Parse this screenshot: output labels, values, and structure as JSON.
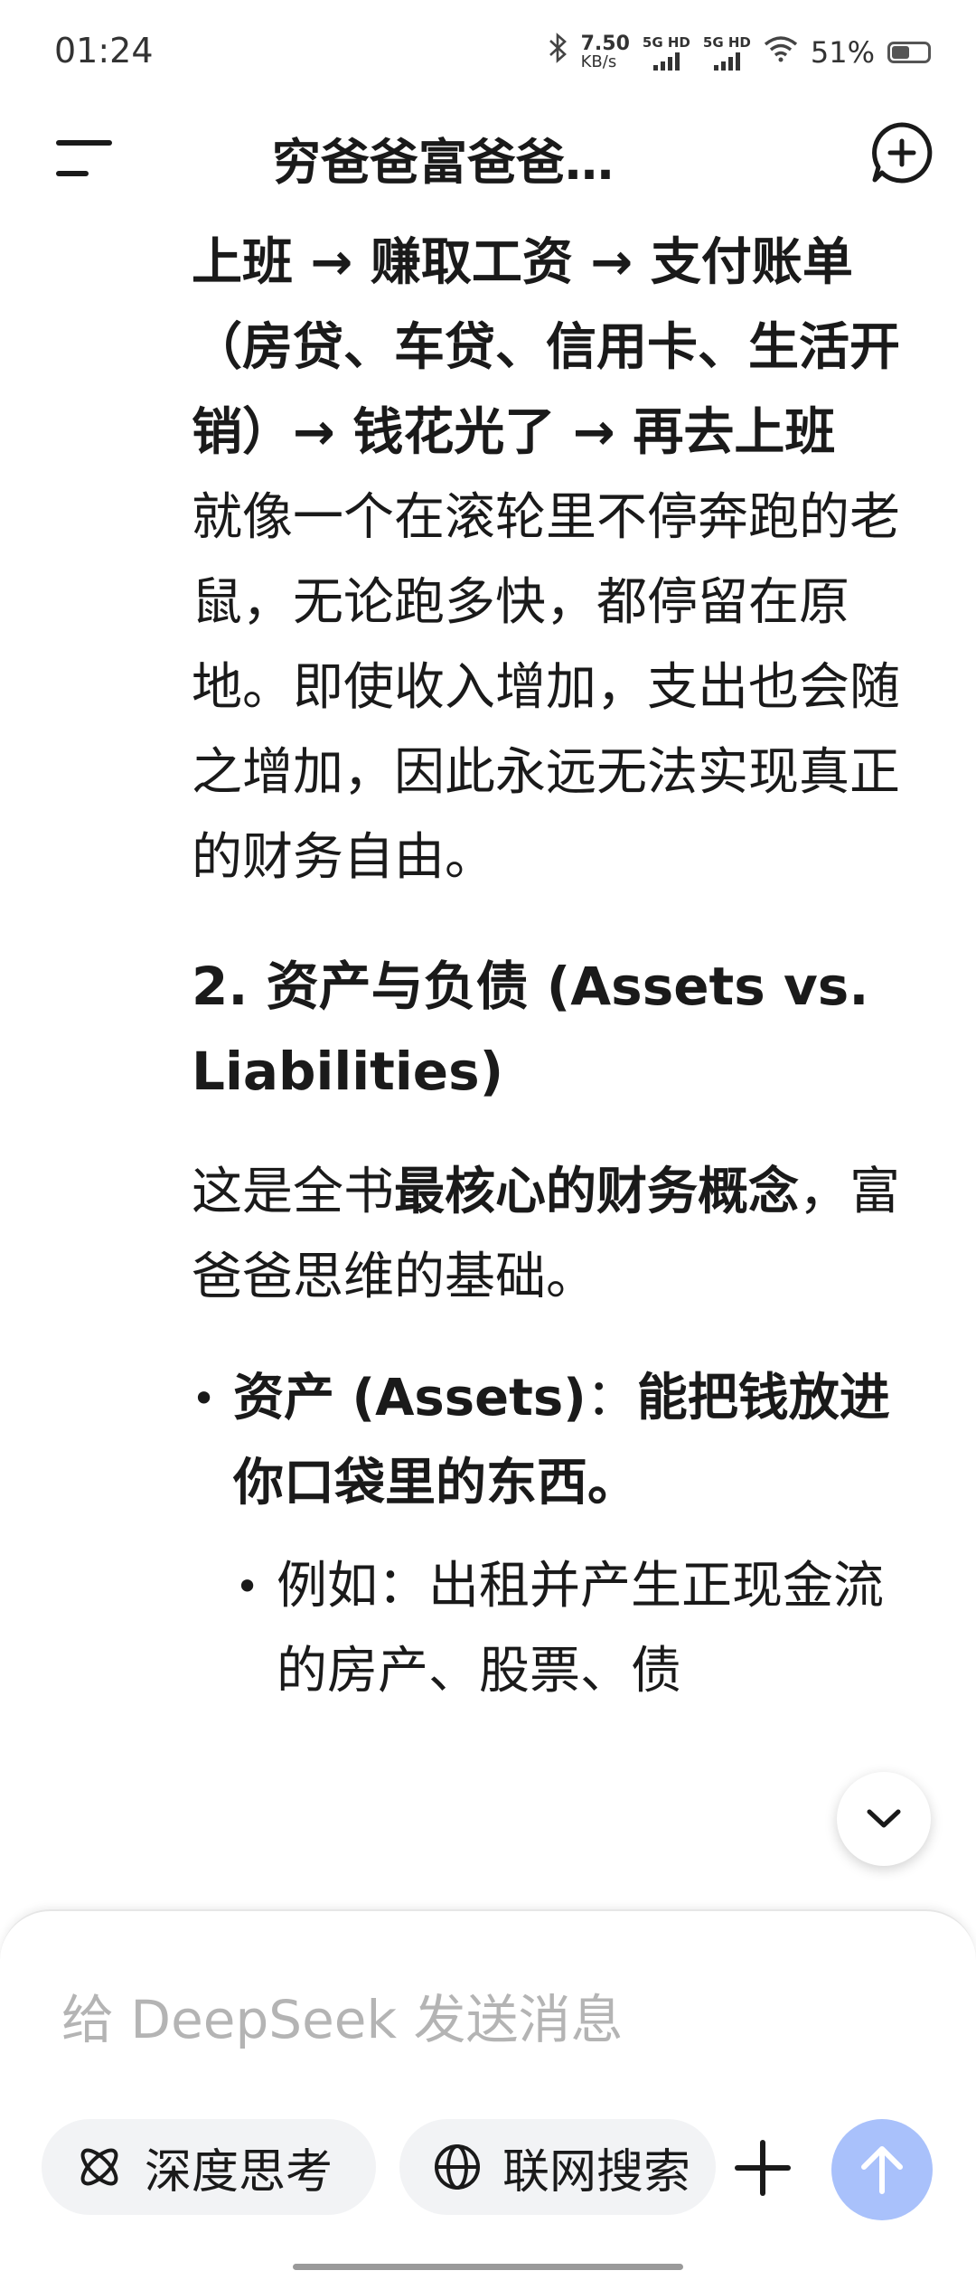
{
  "status_bar": {
    "time": "01:24",
    "net_speed_value": "7.50",
    "net_speed_unit": "KB/s",
    "signal_1": "5G HD",
    "signal_2": "5G HD",
    "battery_percent": "51%",
    "battery_level": 0.51
  },
  "header": {
    "title": "穷爸爸富爸爸…"
  },
  "content": {
    "cycle_text": "上班 → 赚取工资 → 支付账单（房贷、车贷、信用卡、生活开销）→ 钱花光了 → 再去上班",
    "rat_race_text": "就像一个在滚轮里不停奔跑的老鼠，无论跑多快，都停留在原地。即使收入增加，支出也会随之增加，因此永远无法实现真正的财务自由。",
    "section_heading": "2. 资产与负债 (Assets vs. Liabilities)",
    "intro_prefix": "这是全书",
    "intro_bold": "最核心的财务概念",
    "intro_suffix": "，富爸爸思维的基础。",
    "asset_label": "资产 (Assets)",
    "asset_colon": "：",
    "asset_definition": "能把钱放进你口袋里的东西。",
    "asset_example": "例如：出租并产生正现金流的房产、股票、债"
  },
  "composer": {
    "placeholder": "给 DeepSeek 发送消息",
    "deep_think_label": "深度思考",
    "web_search_label": "联网搜索"
  },
  "colors": {
    "send_button": "#a9c1fb",
    "pill_bg": "#f2f3f5"
  }
}
